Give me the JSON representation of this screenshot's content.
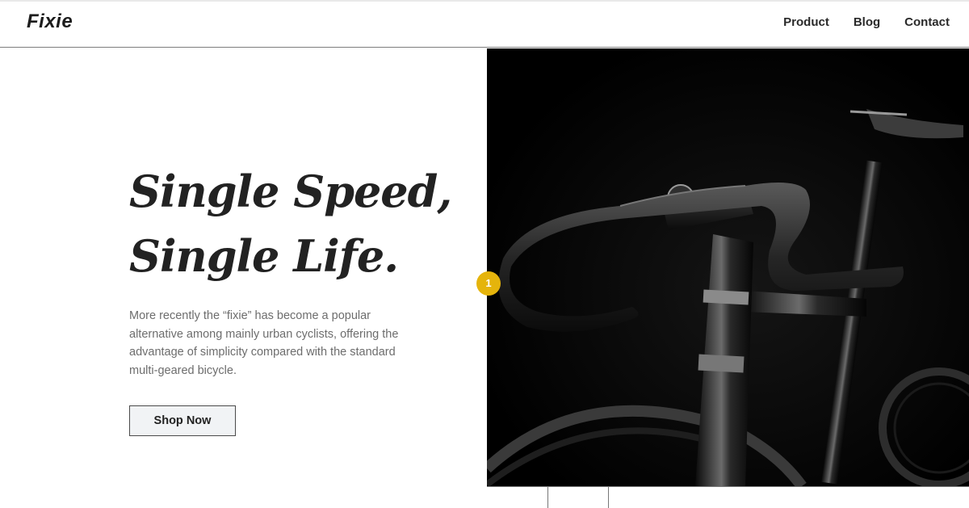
{
  "brand": {
    "logo": "Fixie"
  },
  "nav": {
    "items": [
      "Product",
      "Blog",
      "Contact"
    ]
  },
  "hero": {
    "title_line1": "Single Speed,",
    "title_line2": "Single Life.",
    "description": "More recently the “fixie” has become a popular alternative among mainly urban cyclists, offering the advantage of simplicity compared with the standard multi-geared bicycle.",
    "cta_label": "Shop Now",
    "image_icon": "bicycle-photo"
  },
  "marker": {
    "label": "1",
    "color": "#e5b40c"
  }
}
